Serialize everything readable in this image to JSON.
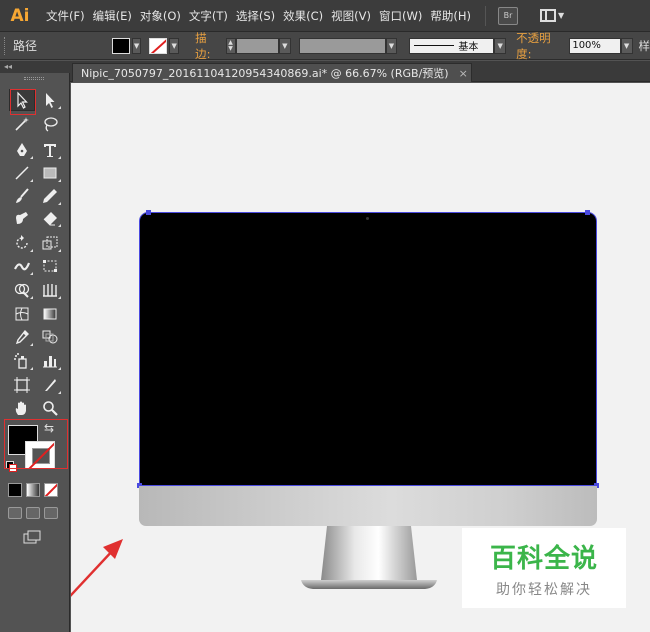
{
  "app": {
    "logo": "Ai",
    "menu": [
      "文件(F)",
      "编辑(E)",
      "对象(O)",
      "文字(T)",
      "选择(S)",
      "效果(C)",
      "视图(V)",
      "窗口(W)",
      "帮助(H)"
    ],
    "bridge_label": "Br",
    "accent": "#f7a733"
  },
  "control": {
    "object_type": "路径",
    "stroke_label": "描边:",
    "line_style_label": "基本",
    "opacity_label": "不透明度:",
    "opacity_value": "100%",
    "style_label_cut": "样"
  },
  "document": {
    "tab_title": "Nipic_7050797_20161104120954340869.ai*  @  66.67%  (RGB/预览)",
    "close_glyph": "×"
  },
  "tools_panel": {
    "collapse_glyph": "◂◂",
    "swap_glyph": "⇆",
    "items": [
      "selection-tool",
      "direct-selection-tool",
      "magic-wand-tool",
      "lasso-tool",
      "pen-tool",
      "type-tool",
      "line-tool",
      "rectangle-tool",
      "paintbrush-tool",
      "pencil-tool",
      "blob-brush-tool",
      "eraser-tool",
      "rotate-tool",
      "scale-tool",
      "width-tool",
      "free-transform-tool",
      "shape-builder-tool",
      "graph-tool",
      "mesh-tool",
      "gradient-tool",
      "eyedropper-tool",
      "blend-tool",
      "symbol-sprayer-tool",
      "column-graph-tool",
      "artboard-tool",
      "slice-tool",
      "hand-tool",
      "zoom-tool"
    ],
    "fill_color": "#000000",
    "highlight_color": "#e03030"
  },
  "canvas": {
    "selection_color": "#4a4adf",
    "arrow_color": "#e03030"
  },
  "watermark": {
    "title": "百科全说",
    "subtitle": "助你轻松解决",
    "color": "#3bb54a"
  }
}
